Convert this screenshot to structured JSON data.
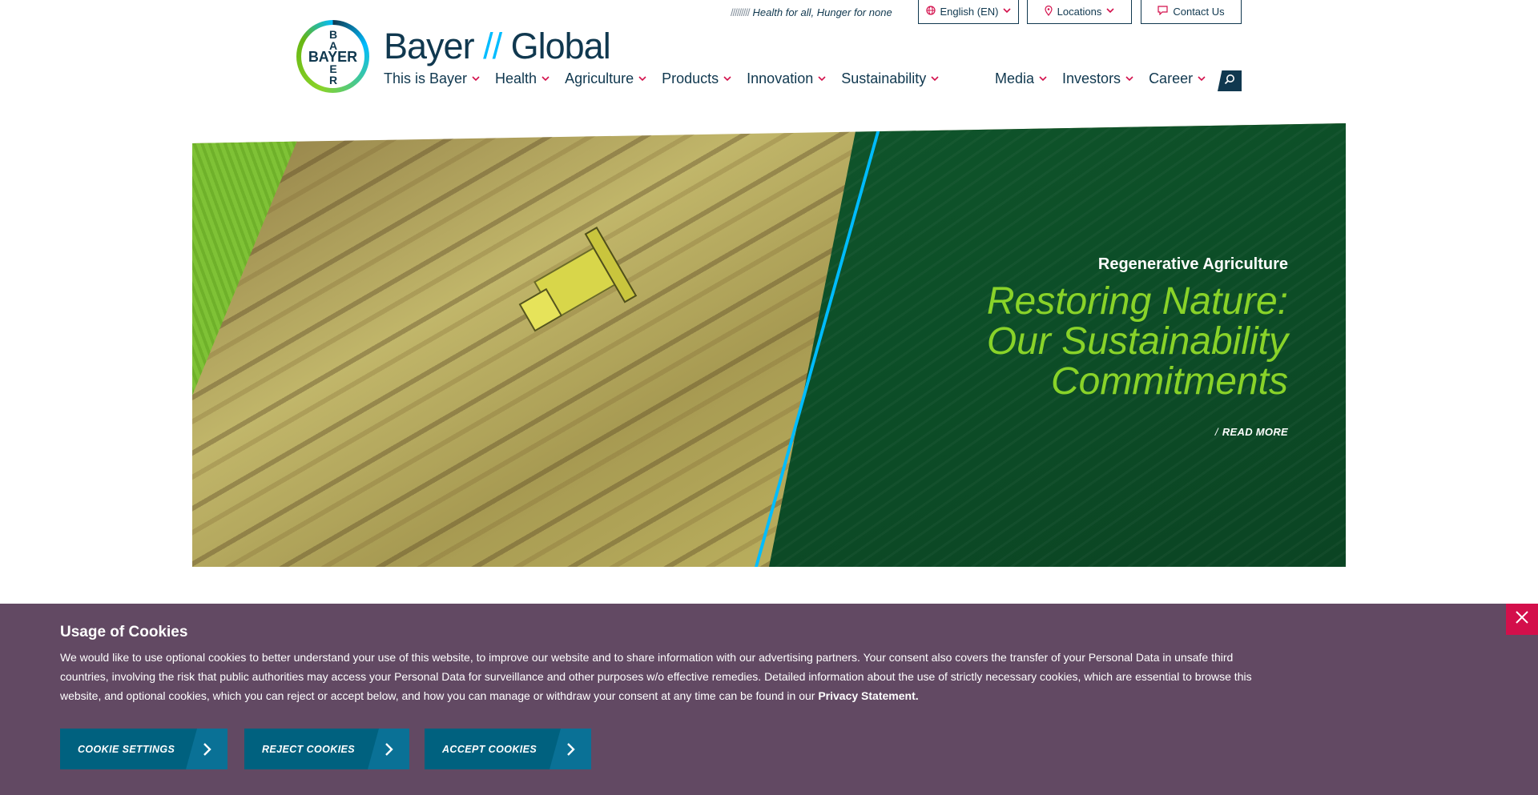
{
  "header": {
    "tagline_slashes": "/////////",
    "tagline": "Health for all, Hunger for none",
    "language_label": "English (EN)",
    "locations_label": "Locations",
    "contact_label": "Contact Us",
    "logo_top": "BA",
    "logo_middle": "BAYER",
    "logo_bottom": "ER",
    "title_left": "Bayer",
    "title_sep": "//",
    "title_right": "Global",
    "nav_left": [
      "This is Bayer",
      "Health",
      "Agriculture",
      "Products",
      "Innovation",
      "Sustainability"
    ],
    "nav_right": [
      "Media",
      "Investors",
      "Career"
    ]
  },
  "hero": {
    "eyebrow": "Regenerative Agriculture",
    "title_line1": "Restoring Nature:",
    "title_line2": "Our Sustainability",
    "title_line3": "Commitments",
    "link": "READ MORE"
  },
  "cookie": {
    "title": "Usage of Cookies",
    "text": "We would like to use optional cookies to better understand your use of this website, to improve our website and to share information with our advertising partners. Your consent also covers the transfer of your Personal Data in unsafe third countries, involving the risk that public authorities may access your Personal Data for surveillance and other purposes w/o effective remedies. Detailed information about the use of strictly necessary cookies, which are essential to browse this website, and optional cookies, which you can reject or accept below, and how you can manage or withdraw your consent at any time can be found in our",
    "privacy_link": "Privacy Statement.",
    "settings_label": "COOKIE SETTINGS",
    "reject_label": "REJECT COOKIES",
    "accept_label": "ACCEPT COOKIES"
  },
  "colors": {
    "brand_navy": "#10384f",
    "accent_red": "#d30f4b",
    "accent_green": "#89d329",
    "accent_blue": "#00bcff",
    "cookie_bg": "#624963",
    "button_blue": "#00617f"
  },
  "icons": [
    "globe-icon",
    "location-pin-icon",
    "chat-bubble-icon",
    "chevron-down-icon",
    "search-icon",
    "chevron-right-icon",
    "close-icon"
  ]
}
